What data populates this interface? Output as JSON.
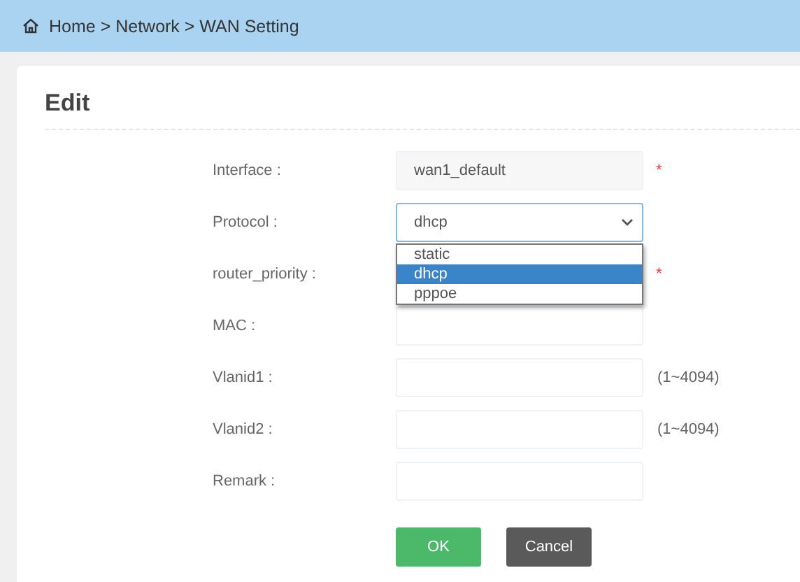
{
  "breadcrumb": "Home > Network > WAN Setting",
  "card": {
    "title": "Edit"
  },
  "fields": [
    {
      "label": "Interface :",
      "kind": "readonly",
      "value": "wan1_default",
      "required_mark": "*"
    },
    {
      "label": "Protocol :",
      "kind": "select",
      "value": "dhcp",
      "options": [
        {
          "label": "static",
          "selected": false
        },
        {
          "label": "dhcp",
          "selected": true
        },
        {
          "label": "pppoe",
          "selected": false
        }
      ]
    },
    {
      "label": "router_priority :",
      "kind": "covered",
      "required_mark": "*"
    },
    {
      "label": "MAC :",
      "kind": "text"
    },
    {
      "label": "Vlanid1 :",
      "kind": "text",
      "hint": "(1~4094)"
    },
    {
      "label": "Vlanid2 :",
      "kind": "text",
      "hint": "(1~4094)"
    },
    {
      "label": "Remark :",
      "kind": "text"
    }
  ],
  "buttons": [
    {
      "label": "OK",
      "kind": "primary"
    },
    {
      "label": "Cancel",
      "kind": "secondary"
    }
  ]
}
